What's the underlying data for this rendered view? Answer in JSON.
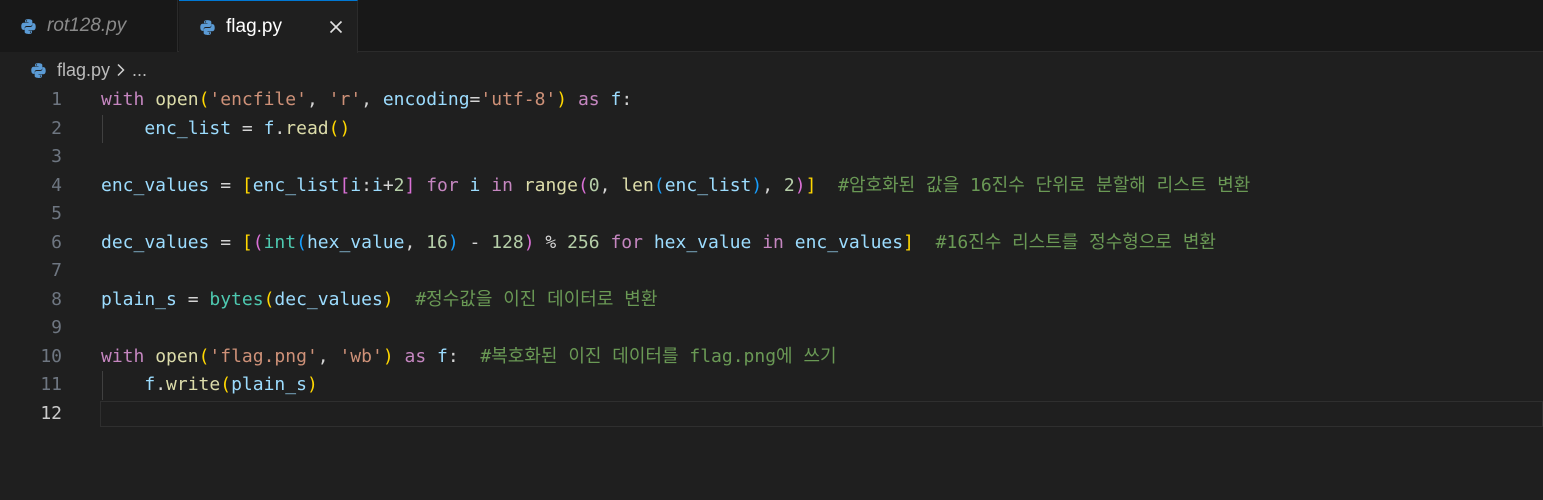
{
  "tabs": [
    {
      "label": "rot128.py",
      "active": false
    },
    {
      "label": "flag.py",
      "active": true
    }
  ],
  "breadcrumb": {
    "file": "flag.py",
    "ellipsis": "..."
  },
  "icons": {
    "file_icon": "python-icon",
    "close": "close-icon",
    "chevron": "chevron-right-icon"
  },
  "colors": {
    "accent": "#0078d4",
    "background": "#1f1f1f",
    "tabbar": "#181818"
  },
  "editor": {
    "active_line": 12,
    "lines": [
      {
        "n": "1",
        "tokens": [
          [
            "kw",
            "with"
          ],
          [
            "op",
            " "
          ],
          [
            "fn",
            "open"
          ],
          [
            "b1",
            "("
          ],
          [
            "str",
            "'encfile'"
          ],
          [
            "op",
            ", "
          ],
          [
            "str",
            "'r'"
          ],
          [
            "op",
            ", "
          ],
          [
            "var",
            "encoding"
          ],
          [
            "op",
            "="
          ],
          [
            "str",
            "'utf-8'"
          ],
          [
            "b1",
            ")"
          ],
          [
            "op",
            " "
          ],
          [
            "kw",
            "as"
          ],
          [
            "op",
            " "
          ],
          [
            "var",
            "f"
          ],
          [
            "op",
            ":"
          ]
        ]
      },
      {
        "n": "2",
        "tokens": [
          [
            "op",
            "    "
          ],
          [
            "var",
            "enc_list"
          ],
          [
            "op",
            " = "
          ],
          [
            "var",
            "f"
          ],
          [
            "op",
            "."
          ],
          [
            "fn",
            "read"
          ],
          [
            "b1",
            "()"
          ]
        ]
      },
      {
        "n": "3",
        "tokens": []
      },
      {
        "n": "4",
        "tokens": [
          [
            "var",
            "enc_values"
          ],
          [
            "op",
            " = "
          ],
          [
            "b1",
            "["
          ],
          [
            "var",
            "enc_list"
          ],
          [
            "b2",
            "["
          ],
          [
            "var",
            "i"
          ],
          [
            "op",
            ":"
          ],
          [
            "var",
            "i"
          ],
          [
            "op",
            "+"
          ],
          [
            "num",
            "2"
          ],
          [
            "b2",
            "]"
          ],
          [
            "op",
            " "
          ],
          [
            "kw",
            "for"
          ],
          [
            "op",
            " "
          ],
          [
            "var",
            "i"
          ],
          [
            "op",
            " "
          ],
          [
            "kw",
            "in"
          ],
          [
            "op",
            " "
          ],
          [
            "fn",
            "range"
          ],
          [
            "b2",
            "("
          ],
          [
            "num",
            "0"
          ],
          [
            "op",
            ", "
          ],
          [
            "fn",
            "len"
          ],
          [
            "b3",
            "("
          ],
          [
            "var",
            "enc_list"
          ],
          [
            "b3",
            ")"
          ],
          [
            "op",
            ", "
          ],
          [
            "num",
            "2"
          ],
          [
            "b2",
            ")"
          ],
          [
            "b1",
            "]"
          ],
          [
            "op",
            "  "
          ],
          [
            "cm",
            "#암호화된 값을 16진수 단위로 분할해 리스트 변환"
          ]
        ]
      },
      {
        "n": "5",
        "tokens": []
      },
      {
        "n": "6",
        "tokens": [
          [
            "var",
            "dec_values"
          ],
          [
            "op",
            " = "
          ],
          [
            "b1",
            "["
          ],
          [
            "b2",
            "("
          ],
          [
            "cls",
            "int"
          ],
          [
            "b3",
            "("
          ],
          [
            "var",
            "hex_value"
          ],
          [
            "op",
            ", "
          ],
          [
            "num",
            "16"
          ],
          [
            "b3",
            ")"
          ],
          [
            "op",
            " - "
          ],
          [
            "num",
            "128"
          ],
          [
            "b2",
            ")"
          ],
          [
            "op",
            " % "
          ],
          [
            "num",
            "256"
          ],
          [
            "op",
            " "
          ],
          [
            "kw",
            "for"
          ],
          [
            "op",
            " "
          ],
          [
            "var",
            "hex_value"
          ],
          [
            "op",
            " "
          ],
          [
            "kw",
            "in"
          ],
          [
            "op",
            " "
          ],
          [
            "var",
            "enc_values"
          ],
          [
            "b1",
            "]"
          ],
          [
            "op",
            "  "
          ],
          [
            "cm",
            "#16진수 리스트를 정수형으로 변환"
          ]
        ]
      },
      {
        "n": "7",
        "tokens": []
      },
      {
        "n": "8",
        "tokens": [
          [
            "var",
            "plain_s"
          ],
          [
            "op",
            " = "
          ],
          [
            "cls",
            "bytes"
          ],
          [
            "b1",
            "("
          ],
          [
            "var",
            "dec_values"
          ],
          [
            "b1",
            ")"
          ],
          [
            "op",
            "  "
          ],
          [
            "cm",
            "#정수값을 이진 데이터로 변환"
          ]
        ]
      },
      {
        "n": "9",
        "tokens": []
      },
      {
        "n": "10",
        "tokens": [
          [
            "kw",
            "with"
          ],
          [
            "op",
            " "
          ],
          [
            "fn",
            "open"
          ],
          [
            "b1",
            "("
          ],
          [
            "str",
            "'flag.png'"
          ],
          [
            "op",
            ", "
          ],
          [
            "str",
            "'wb'"
          ],
          [
            "b1",
            ")"
          ],
          [
            "op",
            " "
          ],
          [
            "kw",
            "as"
          ],
          [
            "op",
            " "
          ],
          [
            "var",
            "f"
          ],
          [
            "op",
            ":  "
          ],
          [
            "cm",
            "#복호화된 이진 데이터를 flag.png에 쓰기"
          ]
        ]
      },
      {
        "n": "11",
        "tokens": [
          [
            "op",
            "    "
          ],
          [
            "var",
            "f"
          ],
          [
            "op",
            "."
          ],
          [
            "fn",
            "write"
          ],
          [
            "b1",
            "("
          ],
          [
            "var",
            "plain_s"
          ],
          [
            "b1",
            ")"
          ]
        ]
      },
      {
        "n": "12",
        "tokens": []
      }
    ]
  }
}
